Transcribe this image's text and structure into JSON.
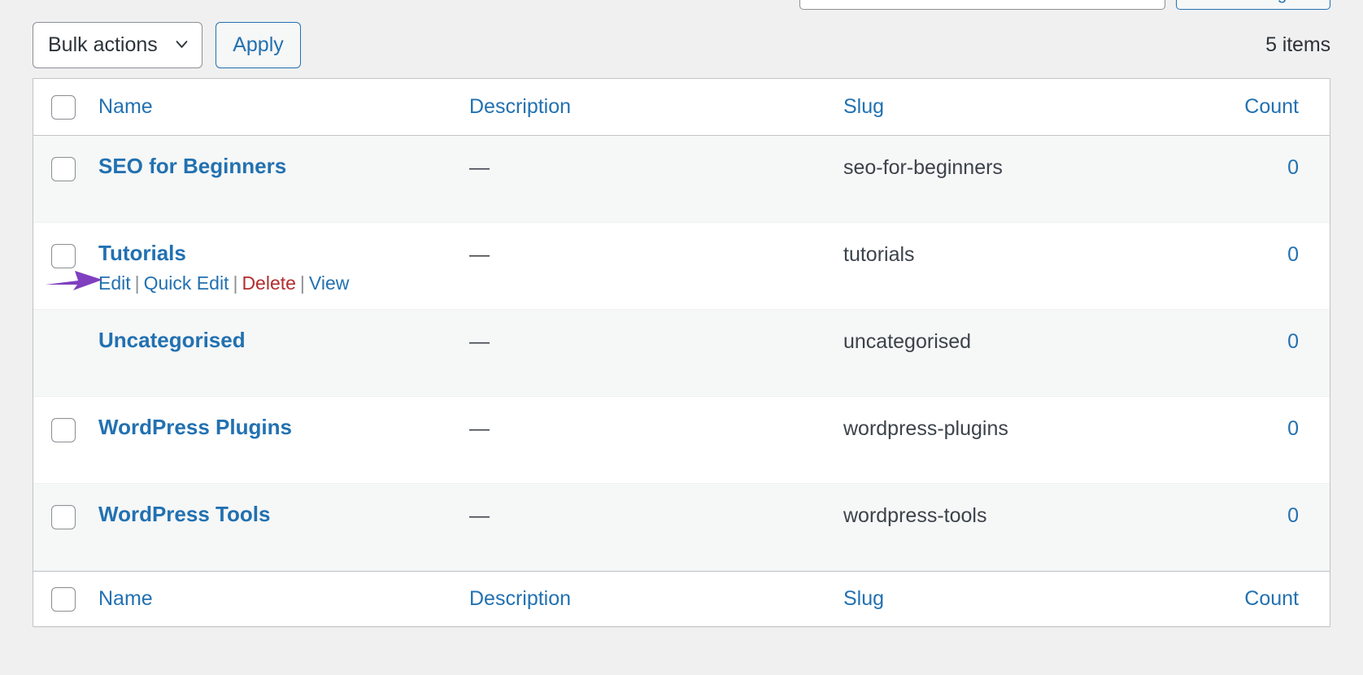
{
  "search": {
    "placeholder": "",
    "value": "",
    "submit_label": "Search Categories"
  },
  "tablenav": {
    "bulk_actions_label": "Bulk actions",
    "bulk_chevron_icon": "chevron-down-icon",
    "apply_label": "Apply",
    "items_count": "5 items"
  },
  "table": {
    "columns": {
      "name": "Name",
      "description": "Description",
      "slug": "Slug",
      "count": "Count"
    },
    "rows": [
      {
        "name": "SEO for Beginners",
        "description": "—",
        "slug": "seo-for-beginners",
        "count": "0",
        "has_checkbox": true,
        "show_actions": false
      },
      {
        "name": "Tutorials",
        "description": "—",
        "slug": "tutorials",
        "count": "0",
        "has_checkbox": true,
        "show_actions": true
      },
      {
        "name": "Uncategorised",
        "description": "—",
        "slug": "uncategorised",
        "count": "0",
        "has_checkbox": false,
        "show_actions": false
      },
      {
        "name": "WordPress Plugins",
        "description": "—",
        "slug": "wordpress-plugins",
        "count": "0",
        "has_checkbox": true,
        "show_actions": false
      },
      {
        "name": "WordPress Tools",
        "description": "—",
        "slug": "wordpress-tools",
        "count": "0",
        "has_checkbox": true,
        "show_actions": false
      }
    ],
    "row_actions": {
      "edit": "Edit",
      "quick_edit": "Quick Edit",
      "delete": "Delete",
      "view": "View",
      "separator": "|"
    }
  },
  "annotation": {
    "arrow_icon": "arrow-right-icon",
    "arrow_color": "#7f3fbf",
    "points_at": "Edit"
  },
  "colors": {
    "link": "#2271b1",
    "delete_link": "#b32d2e",
    "text": "#3c434a",
    "border": "#c3c4c7",
    "page_background": "#f0f0f1",
    "stripe_background": "#f6f7f7"
  }
}
